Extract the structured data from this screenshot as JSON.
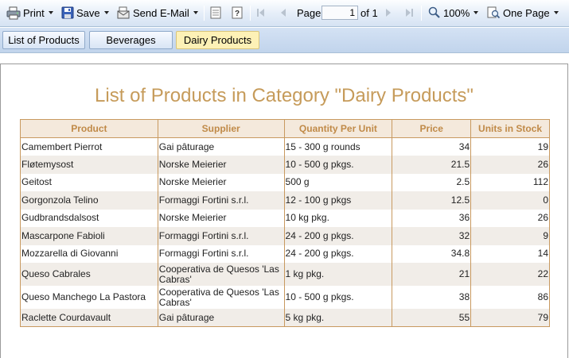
{
  "toolbar": {
    "print_label": "Print",
    "save_label": "Save",
    "email_label": "Send E-Mail",
    "page_label": "Page",
    "page_value": "1",
    "page_of": "of 1",
    "zoom_value": "100%",
    "view_mode": "One Page",
    "icons": [
      "printer-icon",
      "floppy-disk-icon",
      "email-icon",
      "document-map-icon",
      "parameters-icon",
      "first-page-icon",
      "previous-page-icon",
      "next-page-icon",
      "last-page-icon",
      "magnifier-icon",
      "page-view-icon"
    ]
  },
  "tabs": [
    {
      "label": "List of Products",
      "active": false
    },
    {
      "label": "Beverages",
      "active": false
    },
    {
      "label": "Dairy Products",
      "active": true
    }
  ],
  "report": {
    "title": "List of Products in Category \"Dairy Products\"",
    "columns": [
      "Product",
      "Supplier",
      "Quantity Per Unit",
      "Price",
      "Units in Stock"
    ],
    "rows": [
      {
        "product": "Camembert Pierrot",
        "supplier": "Gai pâturage",
        "quantity": "15 - 300 g rounds",
        "price": "34",
        "stock": "19"
      },
      {
        "product": "Fløtemysost",
        "supplier": "Norske Meierier",
        "quantity": "10 - 500 g pkgs.",
        "price": "21.5",
        "stock": "26"
      },
      {
        "product": "Geitost",
        "supplier": "Norske Meierier",
        "quantity": "500 g",
        "price": "2.5",
        "stock": "112"
      },
      {
        "product": "Gorgonzola Telino",
        "supplier": "Formaggi Fortini s.r.l.",
        "quantity": "12 - 100 g pkgs",
        "price": "12.5",
        "stock": "0"
      },
      {
        "product": "Gudbrandsdalsost",
        "supplier": "Norske Meierier",
        "quantity": "10 kg pkg.",
        "price": "36",
        "stock": "26"
      },
      {
        "product": "Mascarpone Fabioli",
        "supplier": "Formaggi Fortini s.r.l.",
        "quantity": "24 - 200 g pkgs.",
        "price": "32",
        "stock": "9"
      },
      {
        "product": "Mozzarella di Giovanni",
        "supplier": "Formaggi Fortini s.r.l.",
        "quantity": "24 - 200 g pkgs.",
        "price": "34.8",
        "stock": "14"
      },
      {
        "product": "Queso Cabrales",
        "supplier": "Cooperativa de Quesos 'Las Cabras'",
        "quantity": "1 kg pkg.",
        "price": "21",
        "stock": "22"
      },
      {
        "product": "Queso Manchego La Pastora",
        "supplier": "Cooperativa de Quesos 'Las Cabras'",
        "quantity": "10 - 500 g pkgs.",
        "price": "38",
        "stock": "86"
      },
      {
        "product": "Raclette Courdavault",
        "supplier": "Gai pâturage",
        "quantity": "5 kg pkg.",
        "price": "55",
        "stock": "79"
      }
    ]
  },
  "colors": {
    "title": "#c69b5a",
    "header_text": "#c08a48",
    "border": "#c8995f",
    "active_tab": "#fdf1b6"
  }
}
